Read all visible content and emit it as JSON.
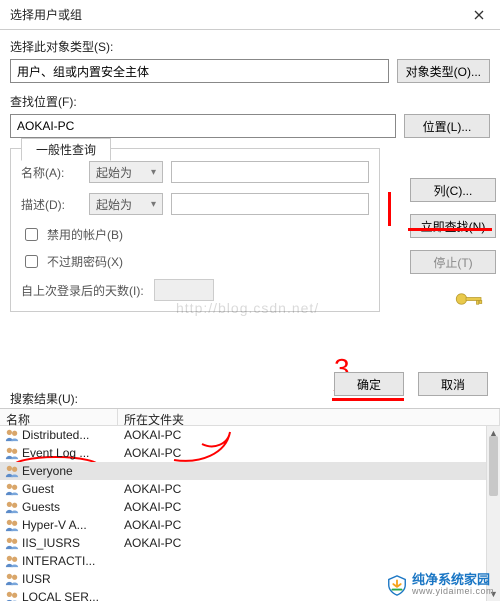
{
  "dialog": {
    "title": "选择用户或组",
    "select_type_label": "选择此对象类型(S):",
    "object_types_value": "用户、组或内置安全主体",
    "object_types_btn": "对象类型(O)...",
    "location_label": "查找位置(F):",
    "location_value": "AOKAI-PC",
    "location_btn": "位置(L)..."
  },
  "query": {
    "tab": "一般性查询",
    "name_label": "名称(A):",
    "name_combo": "起始为",
    "desc_label": "描述(D):",
    "desc_combo": "起始为",
    "chk_disabled": "禁用的帐户(B)",
    "chk_noexpire": "不过期密码(X)",
    "days_label": "自上次登录后的天数(I):"
  },
  "sidebtns": {
    "columns": "列(C)...",
    "findnow": "立即查找(N)",
    "stop": "停止(T)"
  },
  "actions": {
    "ok": "确定",
    "cancel": "取消"
  },
  "results": {
    "label": "搜索结果(U):",
    "col_name": "名称",
    "col_loc": "所在文件夹",
    "items": [
      {
        "name": "Distributed...",
        "loc": "AOKAI-PC",
        "sel": false
      },
      {
        "name": "Event Log ...",
        "loc": "AOKAI-PC",
        "sel": false
      },
      {
        "name": "Everyone",
        "loc": "",
        "sel": true
      },
      {
        "name": "Guest",
        "loc": "AOKAI-PC",
        "sel": false
      },
      {
        "name": "Guests",
        "loc": "AOKAI-PC",
        "sel": false
      },
      {
        "name": "Hyper-V A...",
        "loc": "AOKAI-PC",
        "sel": false
      },
      {
        "name": "IIS_IUSRS",
        "loc": "AOKAI-PC",
        "sel": false
      },
      {
        "name": "INTERACTI...",
        "loc": "",
        "sel": false
      },
      {
        "name": "IUSR",
        "loc": "",
        "sel": false
      },
      {
        "name": "LOCAL SER...",
        "loc": "",
        "sel": false
      }
    ]
  },
  "watermark": "http://blog.csdn.net/",
  "brand": {
    "name": "纯净系统家园",
    "url": "www.yidaimei.com"
  },
  "annot3": "3"
}
